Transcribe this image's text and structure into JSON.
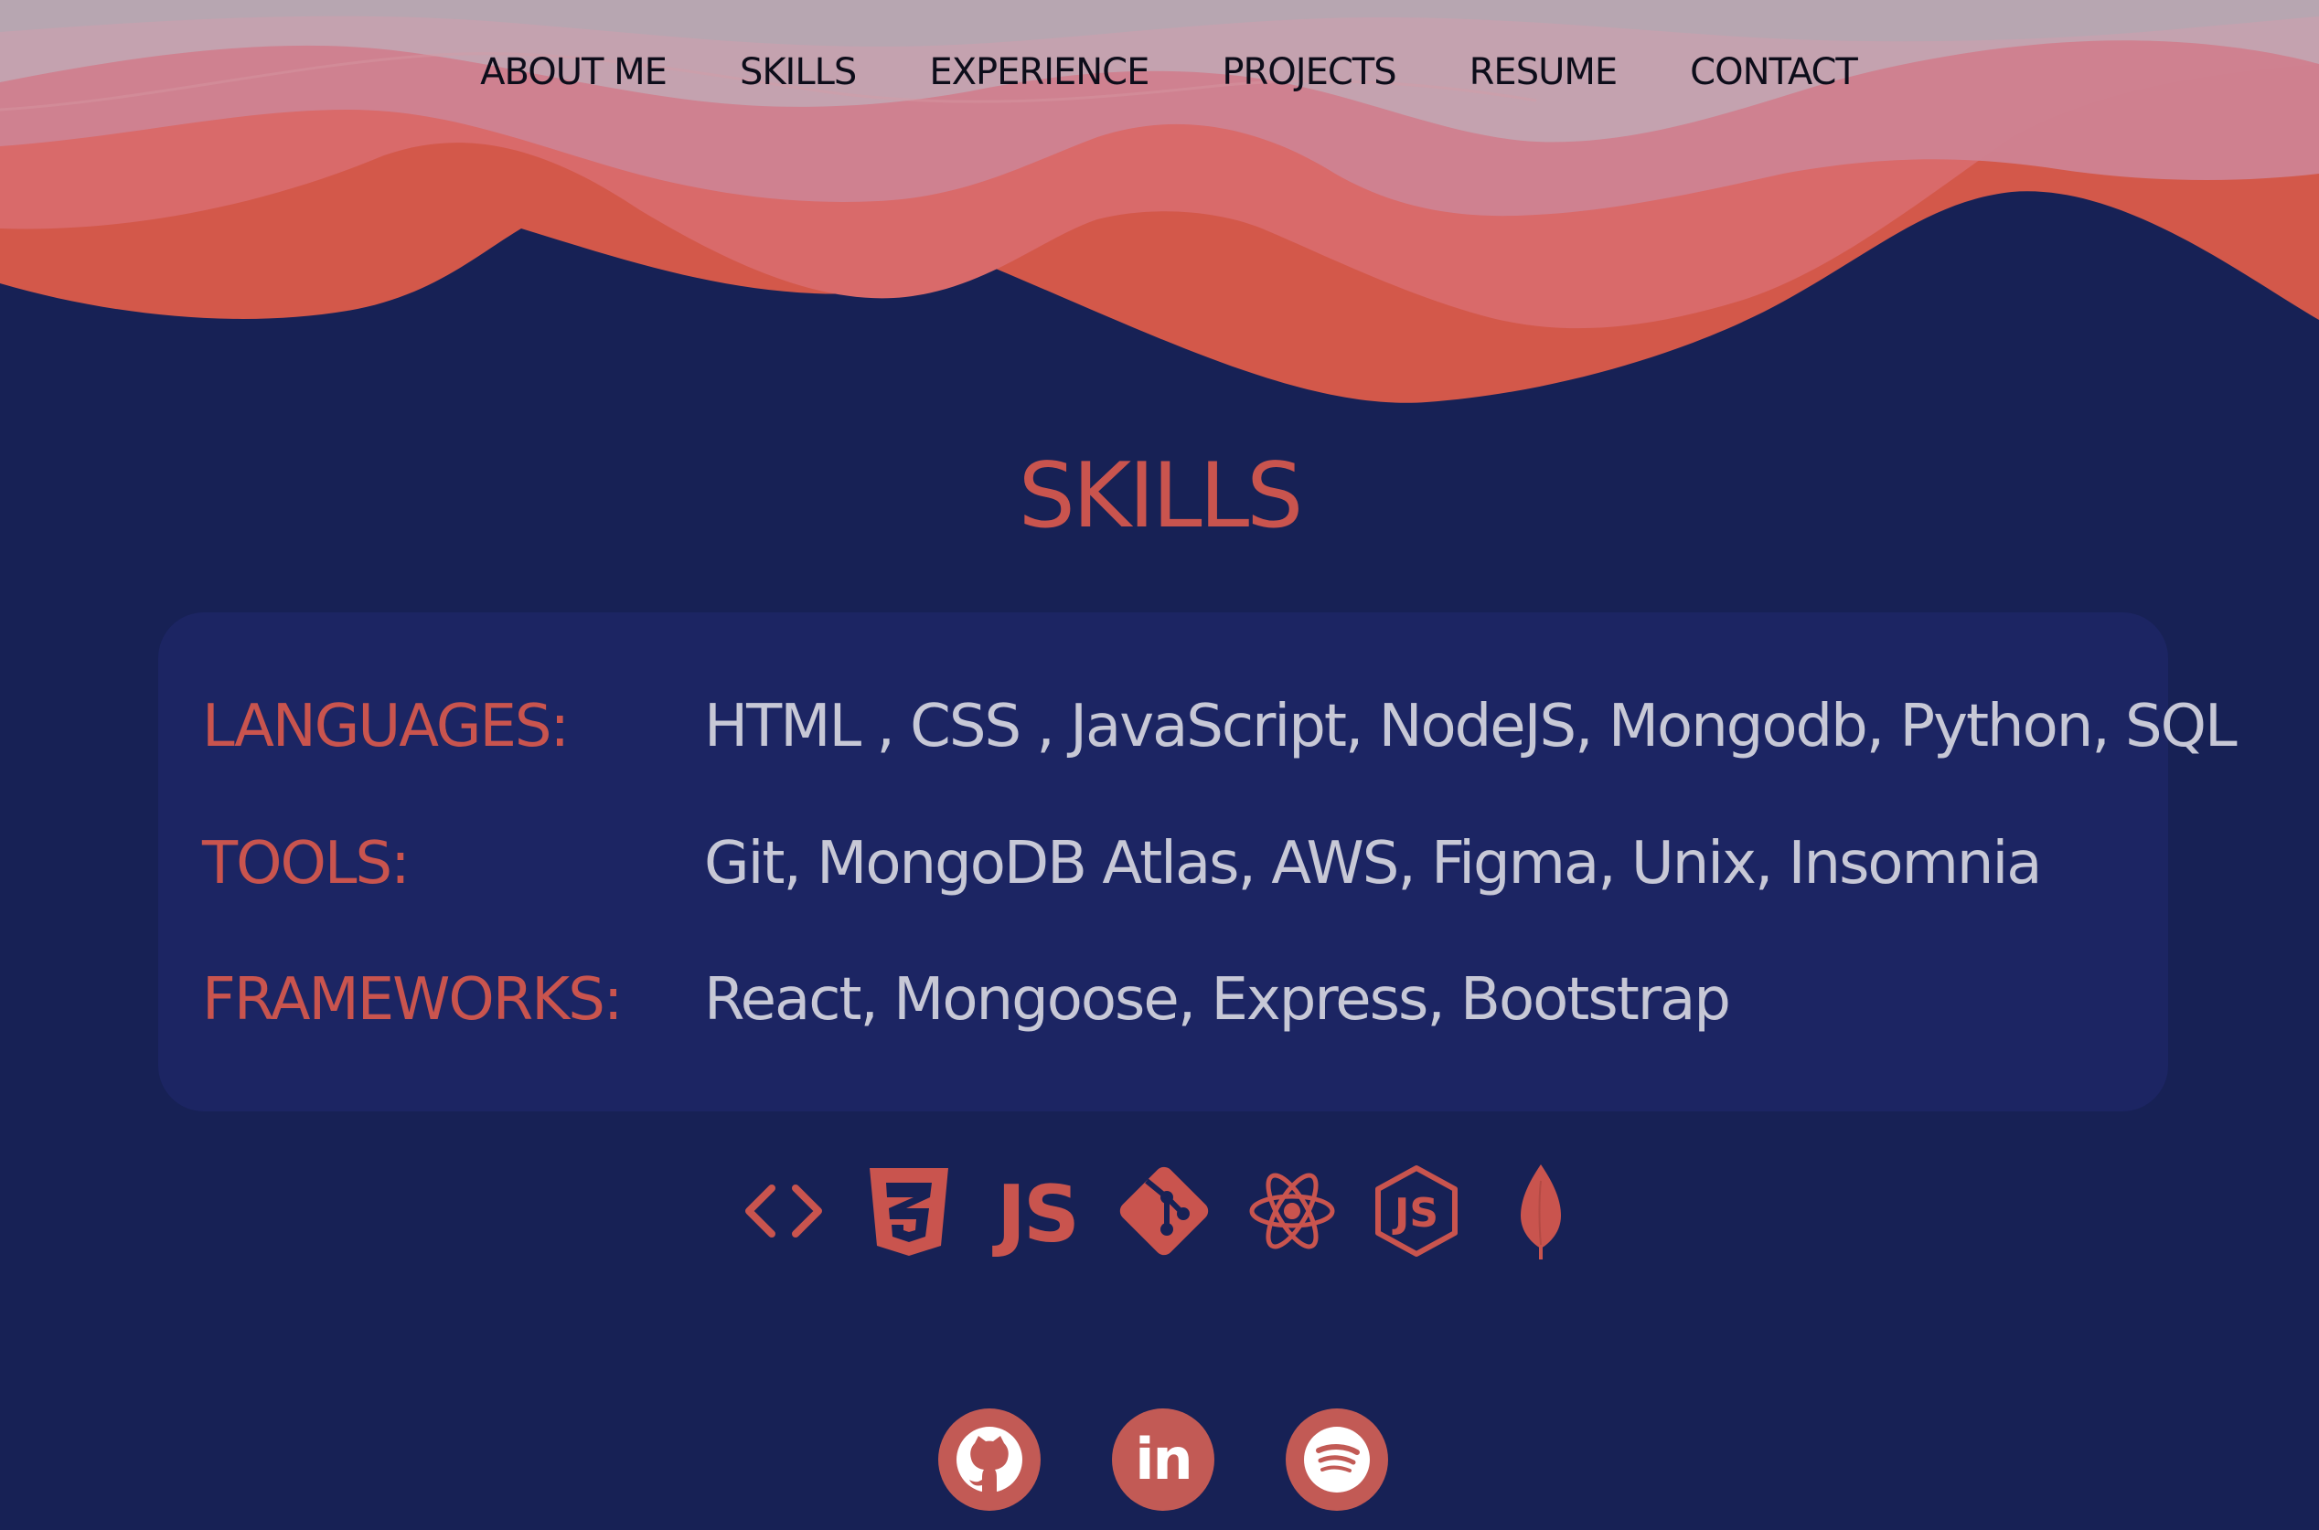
{
  "nav": {
    "items": [
      {
        "label": "ABOUT ME"
      },
      {
        "label": "SKILLS"
      },
      {
        "label": "EXPERIENCE"
      },
      {
        "label": "PROJECTS"
      },
      {
        "label": "RESUME"
      },
      {
        "label": "CONTACT"
      }
    ]
  },
  "skills": {
    "title": "SKILLS",
    "rows": [
      {
        "label": "LANGUAGES:",
        "value": "HTML , CSS , JavaScript, NodeJS, Mongodb, Python, SQL"
      },
      {
        "label": "TOOLS:",
        "value": "Git, MongoDB Atlas, AWS, Figma, Unix, Insomnia"
      },
      {
        "label": "FRAMEWORKS:",
        "value": "React, Mongoose, Express, Bootstrap"
      }
    ]
  },
  "tech_icons": {
    "icons": [
      "html-code-icon",
      "css3-icon",
      "javascript-icon",
      "git-icon",
      "react-icon",
      "nodejs-icon",
      "mongodb-icon"
    ],
    "js_text": "JS",
    "node_text": "JS"
  },
  "social": {
    "icons": [
      "github-icon",
      "linkedin-icon",
      "spotify-icon"
    ],
    "linkedin_text": "in"
  },
  "colors": {
    "background": "#172155",
    "card": "#1c2563",
    "accent": "#c9544e",
    "text_light": "#c7c8d6",
    "nav_text": "#0d0d1a",
    "wave_top": "#b7a6b1",
    "wave_pink": "#cf8392",
    "wave_salmon": "#d96a6a",
    "wave_orange": "#d3584a"
  }
}
